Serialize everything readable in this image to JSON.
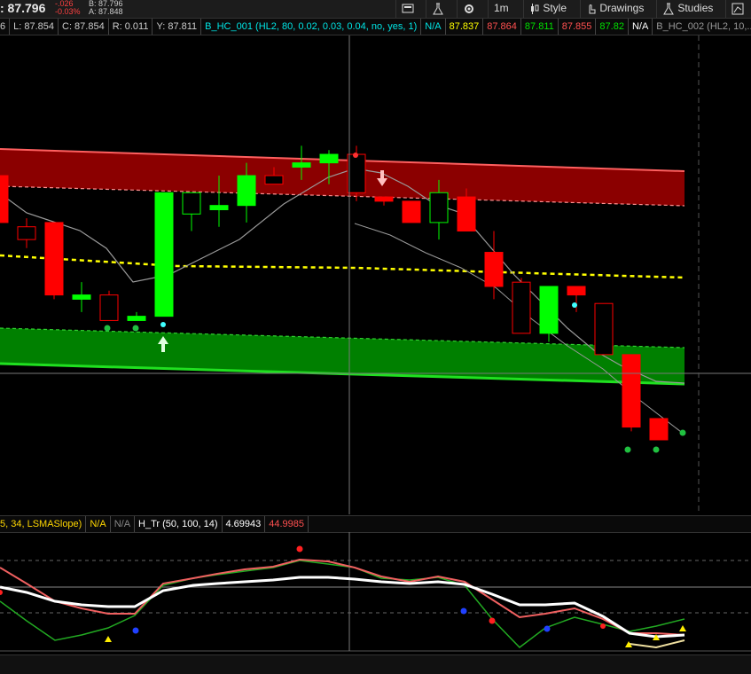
{
  "header": {
    "last_price": ": 87.796",
    "net_change": "-.026",
    "pct_change": "-0.03%",
    "bid": "B: 87.796",
    "ask": "A: 87.848"
  },
  "toolbar": {
    "timeframe": "1m",
    "style_label": "Style",
    "drawings_label": "Drawings",
    "studies_label": "Studies",
    "cut_label": "P"
  },
  "ohlc_bar": {
    "open_partial": "6",
    "low": "L: 87.854",
    "close": "C: 87.854",
    "range": "R: 0.011",
    "y_val": "Y: 87.811",
    "study1_name": "B_HC_001 (HL2, 80, 0.02, 0.03, 0.04, no, yes, 1)",
    "study1_na": "N/A",
    "v1": "87.837",
    "v2": "87.864",
    "v3": "87.811",
    "v4": "87.855",
    "v5": "87.82",
    "study2_na": "N/A",
    "study2_name": "B_HC_002 (HL2, 10,..."
  },
  "study_bar": {
    "lsma_label": "5, 34, LSMASlope)",
    "na1": "N/A",
    "na2": "N/A",
    "htr_label": "H_Tr (50, 100, 14)",
    "htr_v1": "4.69943",
    "htr_v2": "44.9985"
  },
  "colors": {
    "bull": "#00ff00",
    "bear": "#ff0000",
    "upper_band": "#8b0000",
    "lower_band": "#008000",
    "mid_line": "#ffff00"
  },
  "chart_data": [
    {
      "type": "candlestick",
      "candles": [
        {
          "o": 87.95,
          "h": 87.98,
          "l": 87.82,
          "c": 87.84
        },
        {
          "o": 87.83,
          "h": 87.85,
          "l": 87.78,
          "c": 87.8
        },
        {
          "o": 87.84,
          "h": 87.84,
          "l": 87.66,
          "c": 87.67
        },
        {
          "o": 87.66,
          "h": 87.7,
          "l": 87.63,
          "c": 87.67
        },
        {
          "o": 87.67,
          "h": 87.68,
          "l": 87.61,
          "c": 87.61
        },
        {
          "o": 87.61,
          "h": 87.63,
          "l": 87.61,
          "c": 87.62
        },
        {
          "o": 87.62,
          "h": 87.91,
          "l": 87.62,
          "c": 87.91
        },
        {
          "o": 87.86,
          "h": 87.91,
          "l": 87.82,
          "c": 87.91
        },
        {
          "o": 87.87,
          "h": 87.95,
          "l": 87.83,
          "c": 87.88
        },
        {
          "o": 87.88,
          "h": 87.98,
          "l": 87.84,
          "c": 87.95
        },
        {
          "o": 87.95,
          "h": 87.97,
          "l": 87.94,
          "c": 87.93
        },
        {
          "o": 87.97,
          "h": 88.02,
          "l": 87.94,
          "c": 87.98
        },
        {
          "o": 87.98,
          "h": 88.01,
          "l": 87.93,
          "c": 88.0
        },
        {
          "o": 88.0,
          "h": 88.02,
          "l": 87.89,
          "c": 87.91
        },
        {
          "o": 87.9,
          "h": 87.9,
          "l": 87.88,
          "c": 87.89
        },
        {
          "o": 87.89,
          "h": 87.89,
          "l": 87.84,
          "c": 87.84
        },
        {
          "o": 87.84,
          "h": 87.94,
          "l": 87.8,
          "c": 87.91
        },
        {
          "o": 87.9,
          "h": 87.92,
          "l": 87.82,
          "c": 87.82
        },
        {
          "o": 87.77,
          "h": 87.82,
          "l": 87.66,
          "c": 87.69
        },
        {
          "o": 87.7,
          "h": 87.71,
          "l": 87.58,
          "c": 87.58
        },
        {
          "o": 87.58,
          "h": 87.69,
          "l": 87.56,
          "c": 87.69
        },
        {
          "o": 87.69,
          "h": 87.69,
          "l": 87.63,
          "c": 87.67
        },
        {
          "o": 87.65,
          "h": 87.65,
          "l": 87.53,
          "c": 87.53
        },
        {
          "o": 87.53,
          "h": 87.53,
          "l": 87.35,
          "c": 87.36
        },
        {
          "o": 87.38,
          "h": 87.38,
          "l": 87.33,
          "c": 87.33
        }
      ]
    }
  ]
}
